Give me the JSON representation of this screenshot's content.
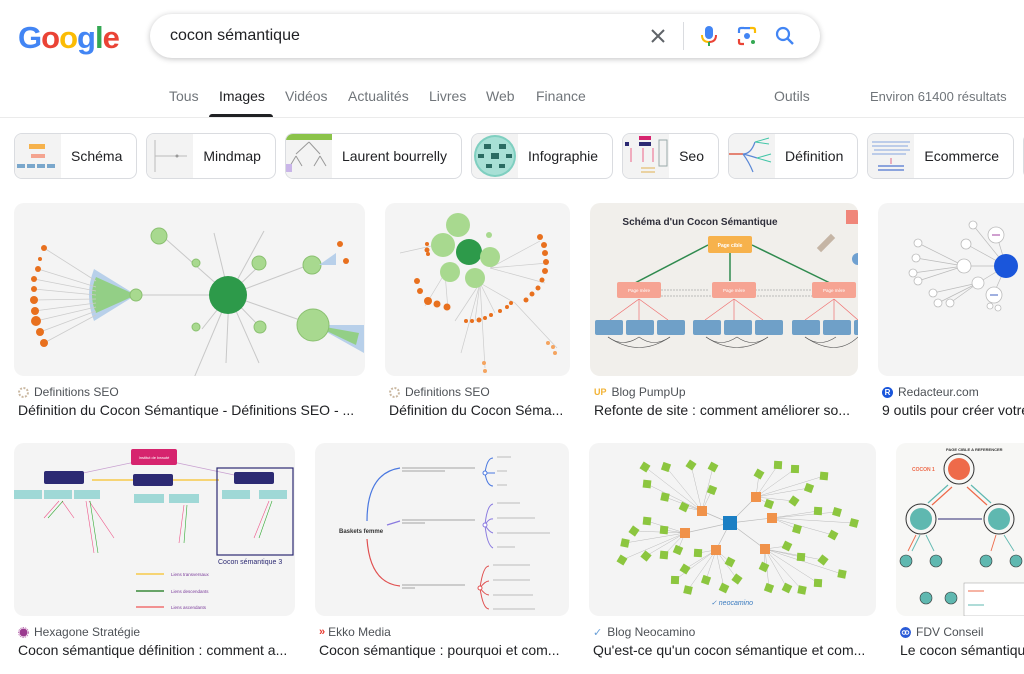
{
  "header": {
    "logo": [
      "G",
      "o",
      "o",
      "g",
      "l",
      "e"
    ],
    "logo_colors": [
      "#4285F4",
      "#EA4335",
      "#FBBC05",
      "#4285F4",
      "#34A853",
      "#EA4335"
    ],
    "search_value": "cocon sémantique",
    "clear_icon": "close-icon",
    "voice_icon": "microphone-icon",
    "lens_icon": "camera-lens-icon",
    "search_icon": "search-icon"
  },
  "tabs": [
    {
      "label": "Tous",
      "active": false
    },
    {
      "label": "Images",
      "active": true
    },
    {
      "label": "Vidéos",
      "active": false
    },
    {
      "label": "Actualités",
      "active": false
    },
    {
      "label": "Livres",
      "active": false
    },
    {
      "label": "Web",
      "active": false
    },
    {
      "label": "Finance",
      "active": false
    }
  ],
  "tools_label": "Outils",
  "results_count": "Environ 61400 résultats",
  "chips": [
    {
      "label": "Schéma"
    },
    {
      "label": "Mindmap"
    },
    {
      "label": "Laurent bourrelly"
    },
    {
      "label": "Infographie"
    },
    {
      "label": "Seo"
    },
    {
      "label": "Définition"
    },
    {
      "label": "Ecommerce"
    }
  ],
  "results": [
    {
      "source": "Definitions SEO",
      "title": "Définition du Cocon Sémantique - Définitions SEO - ...",
      "favicon_color": "#c9b7a0"
    },
    {
      "source": "Definitions SEO",
      "title": "Définition du Cocon Séma...",
      "favicon_color": "#c9b7a0"
    },
    {
      "source": "Blog PumpUp",
      "title": "Refonte de site : comment améliorer so...",
      "favicon_color": "#f2b233",
      "favicon_text": "UP"
    },
    {
      "source": "Redacteur.com",
      "title": "9 outils pour créer votre",
      "favicon_color": "#1a56db",
      "favicon_text": "R"
    },
    {
      "source": "Hexagone Stratégie",
      "title": "Cocon sémantique définition : comment a...",
      "favicon_color": "#9b3a8f"
    },
    {
      "source": "Ekko Media",
      "title": "Cocon sémantique : pourquoi et com...",
      "favicon_color": "#e8392e",
      "favicon_text": "»"
    },
    {
      "source": "Blog Neocamino",
      "title": "Qu'est-ce qu'un cocon sémantique et com...",
      "favicon_color": "#6aa0d8",
      "favicon_text": "✓"
    },
    {
      "source": "FDV Conseil",
      "title": "Le cocon sémantique",
      "favicon_color": "#2a5bd7"
    }
  ],
  "thumb_text": {
    "pumpup_title": "Schéma d'un Cocon Sémantique",
    "pumpup_target": "Page cible",
    "pumpup_mother": "Page mère",
    "hexagone_root": "Institut de beauté",
    "hexagone_caption": "Cocon sémantique 3",
    "hexagone_legend": [
      "Liens transversaux",
      "Liens descendants",
      "Liens ascendants"
    ],
    "ekko_root": "Baskets femme",
    "neocamino_brand": "neocamino",
    "fdv_title": "PAGE CIBLE A REFERENCER",
    "fdv_cocon": "COCON 1"
  }
}
